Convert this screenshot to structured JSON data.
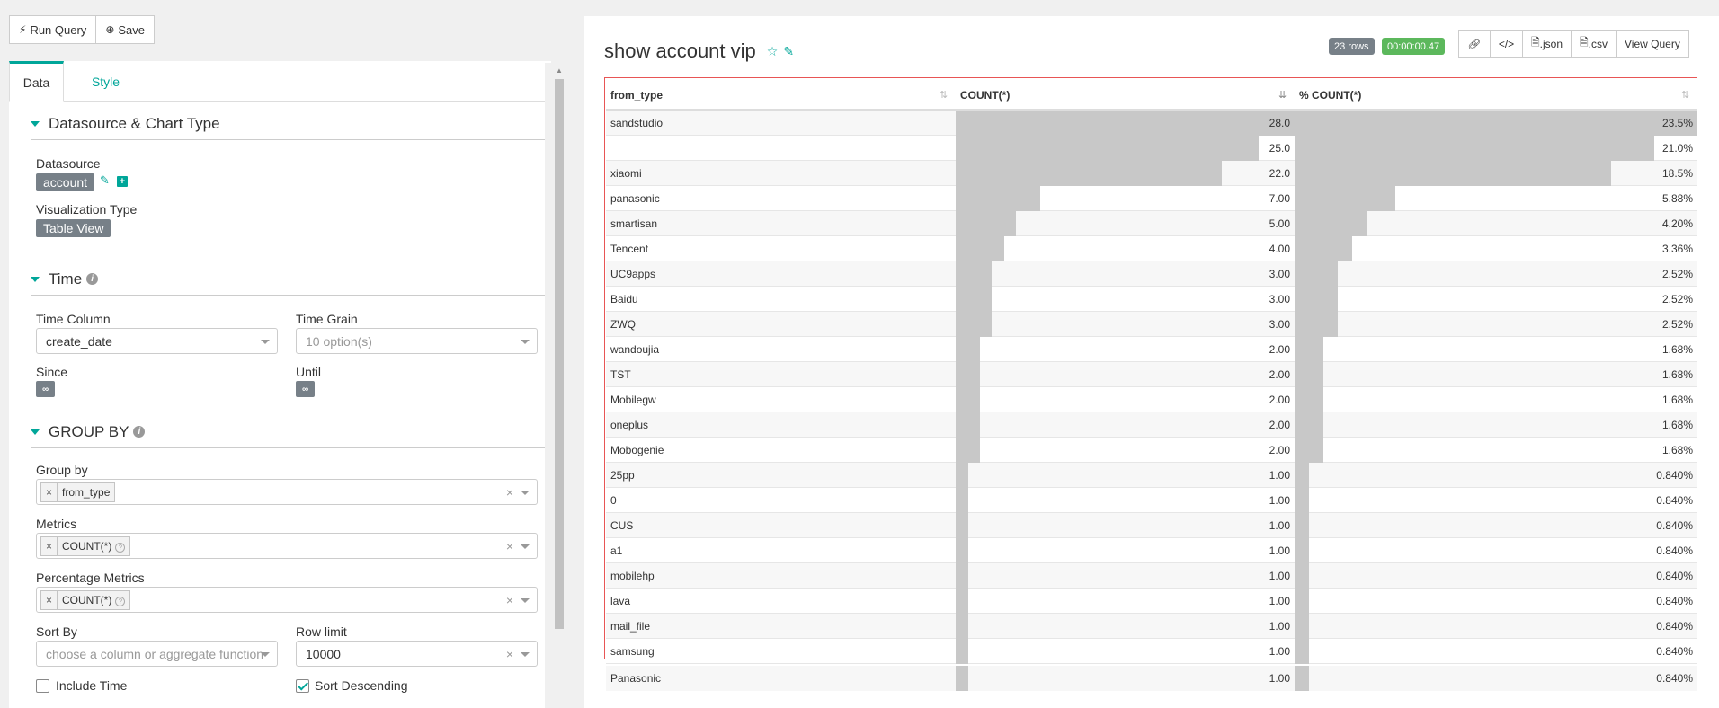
{
  "toolbar": {
    "run_icon": "bolt-icon",
    "run_label": "Run Query",
    "save_icon": "plus-circle-icon",
    "save_label": "Save"
  },
  "tabs": [
    {
      "label": "Data",
      "active": true
    },
    {
      "label": "Style",
      "active": false
    }
  ],
  "sections": {
    "datasource_chart": {
      "title": "Datasource & Chart Type",
      "datasource_label": "Datasource",
      "datasource_value": "account",
      "viz_label": "Visualization Type",
      "viz_value": "Table View"
    },
    "time": {
      "title": "Time",
      "time_column_label": "Time Column",
      "time_column_value": "create_date",
      "time_grain_label": "Time Grain",
      "time_grain_placeholder": "10 option(s)",
      "since_label": "Since",
      "since_value": "∞",
      "until_label": "Until",
      "until_value": "∞"
    },
    "group_by": {
      "title": "GROUP BY",
      "group_by_label": "Group by",
      "group_by_value": "from_type",
      "metrics_label": "Metrics",
      "metrics_value": "COUNT(*)",
      "pct_metrics_label": "Percentage Metrics",
      "pct_metrics_value": "COUNT(*)",
      "sort_by_label": "Sort By",
      "sort_by_placeholder": "choose a column or aggregate function",
      "row_limit_label": "Row limit",
      "row_limit_value": "10000",
      "include_time_label": "Include Time",
      "include_time_checked": false,
      "sort_desc_label": "Sort Descending",
      "sort_desc_checked": true
    }
  },
  "chart": {
    "title": "show account vip",
    "rows_badge": "23 rows",
    "time_badge": "00:00:00.47",
    "rows_badge_color": "#778088",
    "time_badge_color": "#5cb85c",
    "buttons": [
      {
        "icon": "link-icon",
        "label": ""
      },
      {
        "icon": "code-icon",
        "label": ""
      },
      {
        "icon": "file-icon",
        "label": ".json"
      },
      {
        "icon": "file-icon",
        "label": ".csv"
      },
      {
        "icon": "",
        "label": "View Query"
      }
    ],
    "columns": [
      "from_type",
      "COUNT(*)",
      "% COUNT(*)"
    ],
    "rows": [
      {
        "type": "sandstudio",
        "count": "28.0",
        "pct": "23.5%",
        "count_ratio": 1.0,
        "pct_ratio": 1.0
      },
      {
        "type": "",
        "count": "25.0",
        "pct": "21.0%",
        "count_ratio": 0.893,
        "pct_ratio": 0.893
      },
      {
        "type": "xiaomi",
        "count": "22.0",
        "pct": "18.5%",
        "count_ratio": 0.786,
        "pct_ratio": 0.786
      },
      {
        "type": "panasonic",
        "count": "7.00",
        "pct": "5.88%",
        "count_ratio": 0.25,
        "pct_ratio": 0.25
      },
      {
        "type": "smartisan",
        "count": "5.00",
        "pct": "4.20%",
        "count_ratio": 0.179,
        "pct_ratio": 0.179
      },
      {
        "type": "Tencent",
        "count": "4.00",
        "pct": "3.36%",
        "count_ratio": 0.143,
        "pct_ratio": 0.143
      },
      {
        "type": "UC9apps",
        "count": "3.00",
        "pct": "2.52%",
        "count_ratio": 0.107,
        "pct_ratio": 0.107
      },
      {
        "type": "Baidu",
        "count": "3.00",
        "pct": "2.52%",
        "count_ratio": 0.107,
        "pct_ratio": 0.107
      },
      {
        "type": "ZWQ",
        "count": "3.00",
        "pct": "2.52%",
        "count_ratio": 0.107,
        "pct_ratio": 0.107
      },
      {
        "type": "wandoujia",
        "count": "2.00",
        "pct": "1.68%",
        "count_ratio": 0.071,
        "pct_ratio": 0.071
      },
      {
        "type": "TST",
        "count": "2.00",
        "pct": "1.68%",
        "count_ratio": 0.071,
        "pct_ratio": 0.071
      },
      {
        "type": "Mobilegw",
        "count": "2.00",
        "pct": "1.68%",
        "count_ratio": 0.071,
        "pct_ratio": 0.071
      },
      {
        "type": "oneplus",
        "count": "2.00",
        "pct": "1.68%",
        "count_ratio": 0.071,
        "pct_ratio": 0.071
      },
      {
        "type": "Mobogenie",
        "count": "2.00",
        "pct": "1.68%",
        "count_ratio": 0.071,
        "pct_ratio": 0.071
      },
      {
        "type": "25pp",
        "count": "1.00",
        "pct": "0.840%",
        "count_ratio": 0.036,
        "pct_ratio": 0.036
      },
      {
        "type": "0",
        "count": "1.00",
        "pct": "0.840%",
        "count_ratio": 0.036,
        "pct_ratio": 0.036
      },
      {
        "type": "CUS",
        "count": "1.00",
        "pct": "0.840%",
        "count_ratio": 0.036,
        "pct_ratio": 0.036
      },
      {
        "type": "a1",
        "count": "1.00",
        "pct": "0.840%",
        "count_ratio": 0.036,
        "pct_ratio": 0.036
      },
      {
        "type": "mobilehp",
        "count": "1.00",
        "pct": "0.840%",
        "count_ratio": 0.036,
        "pct_ratio": 0.036
      },
      {
        "type": "lava",
        "count": "1.00",
        "pct": "0.840%",
        "count_ratio": 0.036,
        "pct_ratio": 0.036
      },
      {
        "type": "mail_file",
        "count": "1.00",
        "pct": "0.840%",
        "count_ratio": 0.036,
        "pct_ratio": 0.036
      },
      {
        "type": "samsung",
        "count": "1.00",
        "pct": "0.840%",
        "count_ratio": 0.036,
        "pct_ratio": 0.036
      },
      {
        "type": "Panasonic",
        "count": "1.00",
        "pct": "0.840%",
        "count_ratio": 0.036,
        "pct_ratio": 0.036
      }
    ]
  }
}
